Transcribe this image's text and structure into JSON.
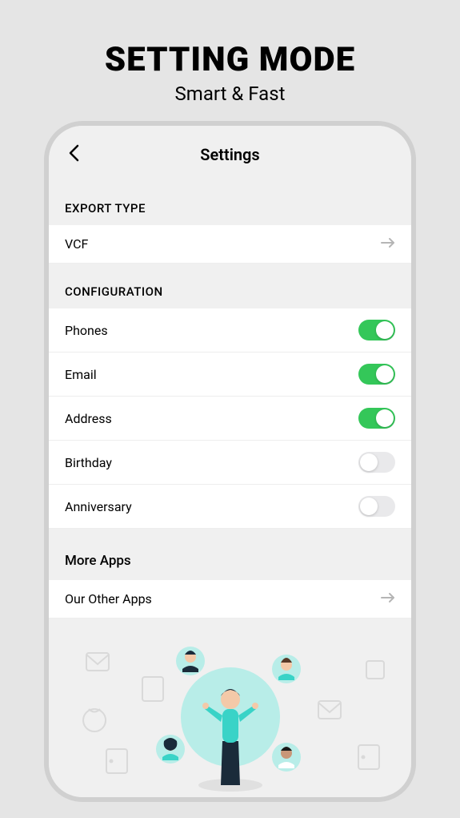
{
  "promo": {
    "title": "SETTING MODE",
    "subtitle": "Smart & Fast"
  },
  "header": {
    "title": "Settings"
  },
  "sections": {
    "export_type": {
      "header": "EXPORT TYPE",
      "value": "VCF"
    },
    "configuration": {
      "header": "CONFIGURATION",
      "items": [
        {
          "label": "Phones",
          "enabled": true
        },
        {
          "label": "Email",
          "enabled": true
        },
        {
          "label": "Address",
          "enabled": true
        },
        {
          "label": "Birthday",
          "enabled": false
        },
        {
          "label": "Anniversary",
          "enabled": false
        }
      ]
    },
    "more_apps": {
      "header": "More Apps",
      "link_label": "Our Other Apps"
    }
  },
  "colors": {
    "toggle_on": "#34c759",
    "toggle_off": "#e9e9eb",
    "accent_teal": "#39d3c7",
    "bg": "#e5e5e5"
  }
}
